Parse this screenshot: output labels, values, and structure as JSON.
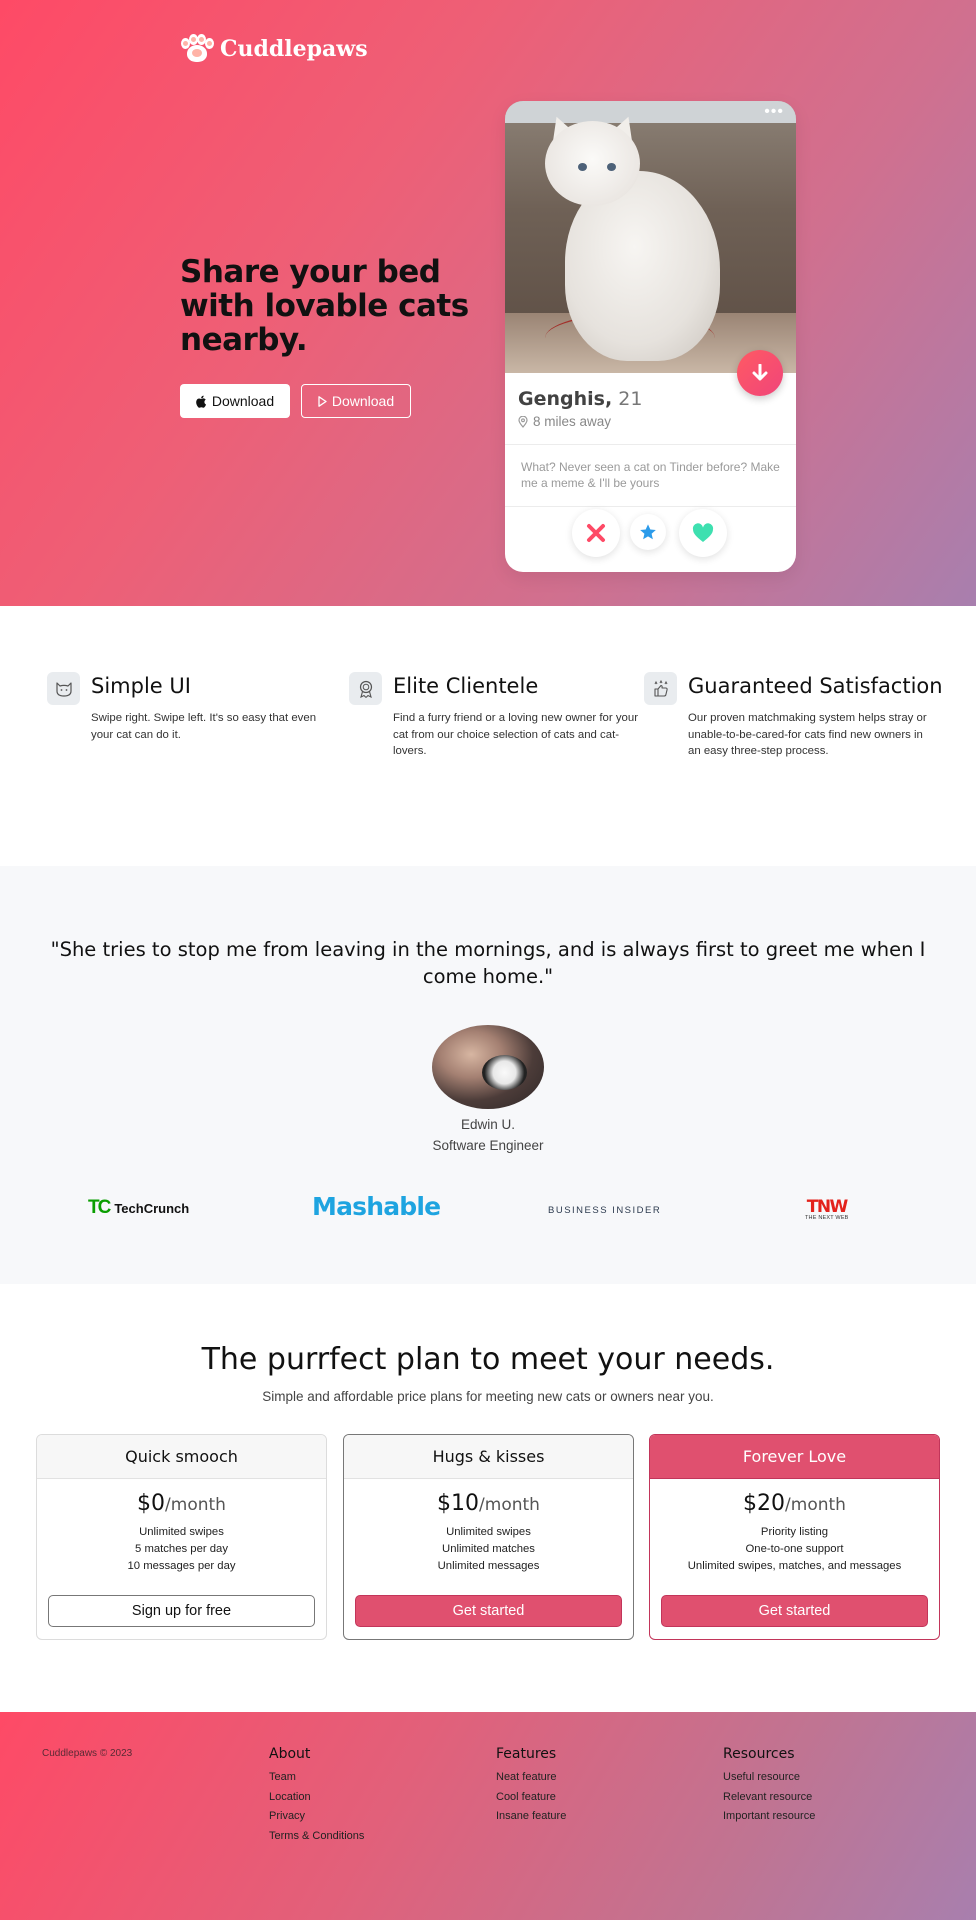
{
  "brand": {
    "name": "Cuddlepaws"
  },
  "hero": {
    "headline": "Share your bed with lovable cats nearby.",
    "buttons": [
      {
        "icon": "apple-icon",
        "label": "Download"
      },
      {
        "icon": "play-store-icon",
        "label": "Download"
      }
    ]
  },
  "profile": {
    "name": "Genghis,",
    "age": "21",
    "distance": "8 miles away",
    "bio": "What? Never seen a cat on Tinder before? Make me a meme & I'll be yours"
  },
  "features": [
    {
      "icon": "cat-face-icon",
      "title": "Simple UI",
      "text": "Swipe right. Swipe left. It's so easy that even your cat can do it."
    },
    {
      "icon": "award-ribbon-icon",
      "title": "Elite Clientele",
      "text": "Find a furry friend or a loving new owner for your cat from our choice selection of cats and cat-lovers."
    },
    {
      "icon": "stars-thumbs-up-icon",
      "title": "Guaranteed Satisfaction",
      "text": "Our proven matchmaking system helps stray or unable-to-be-cared-for cats find new owners in an easy three-step process."
    }
  ],
  "testimonial": {
    "quote": "\"She tries to stop me from leaving in the mornings, and is always first to greet me when I come home.\"",
    "name": "Edwin U.",
    "title": "Software Engineer"
  },
  "press": {
    "techcrunch": "TechCrunch",
    "mashable": "Mashable",
    "business_insider": "BUSINESS INSIDER",
    "tnw": "TNW",
    "tnw_sub": "THE NEXT WEB"
  },
  "pricing": {
    "title": "The purrfect plan to meet your needs.",
    "subtitle": "Simple and affordable price plans for meeting new cats or owners near you.",
    "plans": [
      {
        "name": "Quick smooch",
        "price": "$0",
        "period": "/month",
        "features": [
          "Unlimited swipes",
          "5 matches per day",
          "10 messages per day"
        ],
        "cta": "Sign up for free"
      },
      {
        "name": "Hugs & kisses",
        "price": "$10",
        "period": "/month",
        "features": [
          "Unlimited swipes",
          "Unlimited matches",
          "Unlimited messages"
        ],
        "cta": "Get started"
      },
      {
        "name": "Forever Love",
        "price": "$20",
        "period": "/month",
        "features": [
          "Priority listing",
          "One-to-one support",
          "Unlimited swipes, matches, and messages"
        ],
        "cta": "Get started"
      }
    ]
  },
  "footer": {
    "copyright": "Cuddlepaws © 2023",
    "columns": [
      {
        "title": "About",
        "links": [
          "Team",
          "Location",
          "Privacy",
          "Terms & Conditions"
        ]
      },
      {
        "title": "Features",
        "links": [
          "Neat feature",
          "Cool feature",
          "Insane feature"
        ]
      },
      {
        "title": "Resources",
        "links": [
          "Useful resource",
          "Relevant resource",
          "Important resource"
        ]
      }
    ]
  },
  "colors": {
    "brand_pink": "#fe4a66",
    "brand_purple": "#a87fae",
    "button_red": "#e0506f"
  }
}
